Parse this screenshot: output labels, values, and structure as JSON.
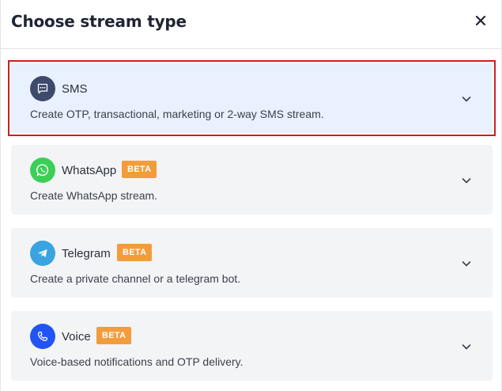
{
  "dialog": {
    "title": "Choose stream type",
    "close_label": "close"
  },
  "options": [
    {
      "name": "SMS",
      "description": "Create OTP, transactional, marketing or 2-way SMS stream.",
      "badge": "",
      "icon": "sms-message-icon",
      "icon_color": "#3e4a6b",
      "selected": true
    },
    {
      "name": "WhatsApp",
      "description": "Create WhatsApp stream.",
      "badge": "BETA",
      "icon": "whatsapp-icon",
      "icon_color": "#3ccf57",
      "selected": false
    },
    {
      "name": "Telegram",
      "description": "Create a private channel or a telegram bot.",
      "badge": "BETA",
      "icon": "telegram-icon",
      "icon_color": "#39a4e0",
      "selected": false
    },
    {
      "name": "Voice",
      "description": "Voice-based notifications and OTP delivery.",
      "badge": "BETA",
      "icon": "phone-icon",
      "icon_color": "#2254f4",
      "selected": false
    }
  ],
  "colors": {
    "selected_outline": "#cc1f1f",
    "selected_bg": "#e8f1fd",
    "badge_bg": "#f39c3b"
  }
}
